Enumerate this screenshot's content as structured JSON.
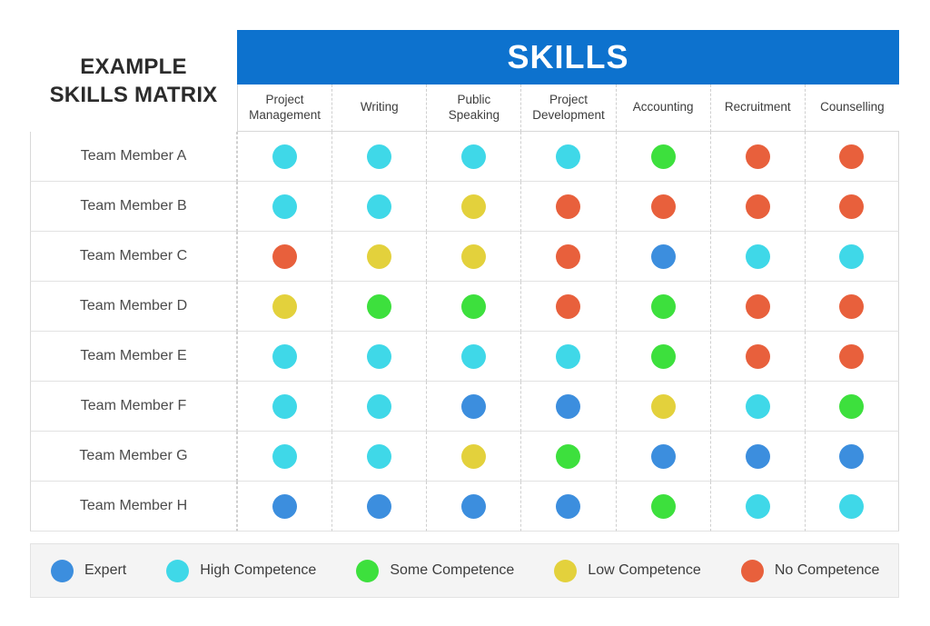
{
  "title": {
    "line1": "EXAMPLE",
    "line2": "SKILLS MATRIX"
  },
  "banner": {
    "label": "SKILLS"
  },
  "colors": {
    "header_blue": "#0d72ce",
    "expert": "#3c8ede",
    "high": "#3fd8e8",
    "some": "#3de03d",
    "low": "#e3d13c",
    "none": "#e8603c",
    "row_stripe": "#f4f4f4",
    "text": "#3d3d3d"
  },
  "chart_data": {
    "type": "heatmap",
    "title": "EXAMPLE SKILLS MATRIX",
    "xlabel": "SKILLS",
    "ylabel": "",
    "categories": [
      "Project Management",
      "Writing",
      "Public Speaking",
      "Project Development",
      "Accounting",
      "Recruitment",
      "Counselling"
    ],
    "rows": [
      {
        "name": "Team Member A",
        "values": [
          "high",
          "high",
          "high",
          "high",
          "some",
          "none",
          "none"
        ]
      },
      {
        "name": "Team Member B",
        "values": [
          "high",
          "high",
          "low",
          "none",
          "none",
          "none",
          "none"
        ]
      },
      {
        "name": "Team Member C",
        "values": [
          "none",
          "low",
          "low",
          "none",
          "expert",
          "high",
          "high"
        ]
      },
      {
        "name": "Team Member D",
        "values": [
          "low",
          "some",
          "some",
          "none",
          "some",
          "none",
          "none"
        ]
      },
      {
        "name": "Team Member E",
        "values": [
          "high",
          "high",
          "high",
          "high",
          "some",
          "none",
          "none"
        ]
      },
      {
        "name": "Team Member F",
        "values": [
          "high",
          "high",
          "expert",
          "expert",
          "low",
          "high",
          "some"
        ]
      },
      {
        "name": "Team Member G",
        "values": [
          "high",
          "high",
          "low",
          "some",
          "expert",
          "expert",
          "expert"
        ]
      },
      {
        "name": "Team Member H",
        "values": [
          "expert",
          "expert",
          "expert",
          "expert",
          "some",
          "high",
          "high"
        ]
      }
    ],
    "scale": [
      {
        "key": "expert",
        "label": "Expert",
        "color": "#3c8ede"
      },
      {
        "key": "high",
        "label": "High Competence",
        "color": "#3fd8e8"
      },
      {
        "key": "some",
        "label": "Some Competence",
        "color": "#3de03d"
      },
      {
        "key": "low",
        "label": "Low Competence",
        "color": "#e3d13c"
      },
      {
        "key": "none",
        "label": "No Competence",
        "color": "#e8603c"
      }
    ],
    "legend_position": "bottom",
    "grid": true
  }
}
